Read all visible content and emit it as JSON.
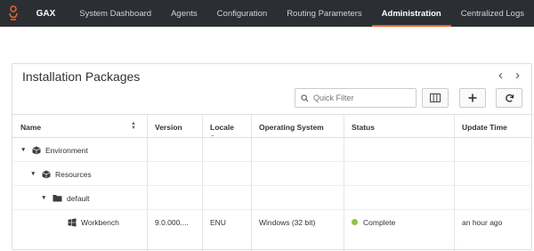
{
  "nav": {
    "app_name": "GAX",
    "items": [
      {
        "label": "System Dashboard"
      },
      {
        "label": "Agents"
      },
      {
        "label": "Configuration"
      },
      {
        "label": "Routing Parameters"
      },
      {
        "label": "Administration"
      },
      {
        "label": "Centralized Logs"
      }
    ],
    "active": "Administration",
    "accent": "#e4632a"
  },
  "panel": {
    "title": "Installation Packages",
    "filter_placeholder": "Quick Filter"
  },
  "table": {
    "columns": {
      "name": "Name",
      "version": "Version",
      "locale": "Locale",
      "os": "Operating System",
      "status": "Status",
      "update_time": "Update Time"
    },
    "rows": [
      {
        "name": "Environment",
        "icon": "cube-icon"
      },
      {
        "name": "Resources",
        "icon": "cube-icon"
      },
      {
        "name": "default",
        "icon": "folder-icon"
      },
      {
        "name": "Workbench",
        "icon": "windows-icon",
        "version": "9.0.000....",
        "locale": "ENU",
        "os": "Windows (32 bit)",
        "status": "Complete",
        "update_time": "an hour ago"
      }
    ]
  }
}
